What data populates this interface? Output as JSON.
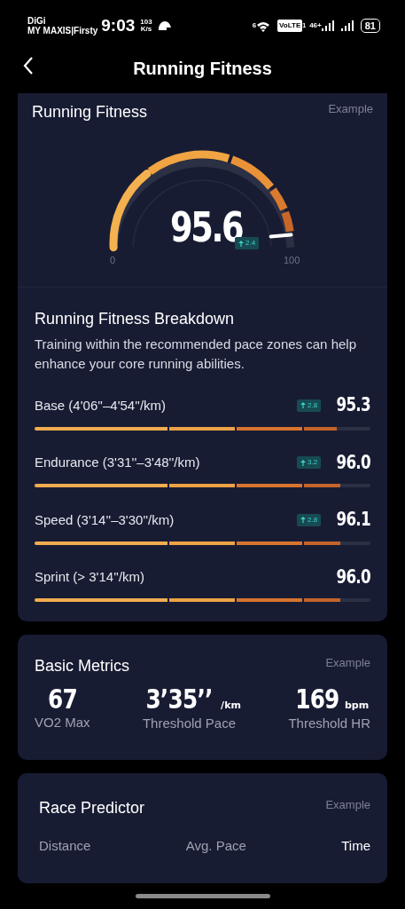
{
  "status_bar": {
    "carrier": "DiGi",
    "network": "MY MAXIS|Firsty",
    "time": "9:03",
    "speed_value": "103",
    "speed_unit": "K/s",
    "wifi_badge": "6",
    "volte": "VoLTE",
    "sim_index": "1",
    "signal_type": "46+",
    "battery": "81"
  },
  "header": {
    "title": "Running Fitness"
  },
  "fitness": {
    "title": "Running Fitness",
    "tag": "Example",
    "score": "95.6",
    "change": "2.4",
    "level": 0.956,
    "min": "0",
    "max": "100"
  },
  "breakdown": {
    "title": "Running Fitness Breakdown",
    "description": "Training within the recommended pace zones can help enhance your core running abilities.",
    "zones": [
      {
        "label": "Base (4'06''–4'54''/km)",
        "change": "2.8",
        "score": "95.3",
        "level": 0.9
      },
      {
        "label": "Endurance (3'31''–3'48''/km)",
        "change": "3.2",
        "score": "96.0",
        "level": 0.91
      },
      {
        "label": "Speed (3'14''–3'30''/km)",
        "change": "2.8",
        "score": "96.1",
        "level": 0.91
      },
      {
        "label": "Sprint (> 3'14''/km)",
        "score": "96.0",
        "level": 0.91
      }
    ]
  },
  "metrics": {
    "title": "Basic Metrics",
    "tag": "Example",
    "items": [
      {
        "value": "67",
        "label": "VO2 Max"
      },
      {
        "value": "3’35’’",
        "unit": "/km",
        "label": "Threshold Pace"
      },
      {
        "value": "169",
        "unit": "bpm",
        "label": "Threshold HR"
      }
    ]
  },
  "race_predictor": {
    "title": "Race Predictor",
    "tag": "Example",
    "columns": [
      "Distance",
      "Avg. Pace",
      "Time"
    ]
  }
}
